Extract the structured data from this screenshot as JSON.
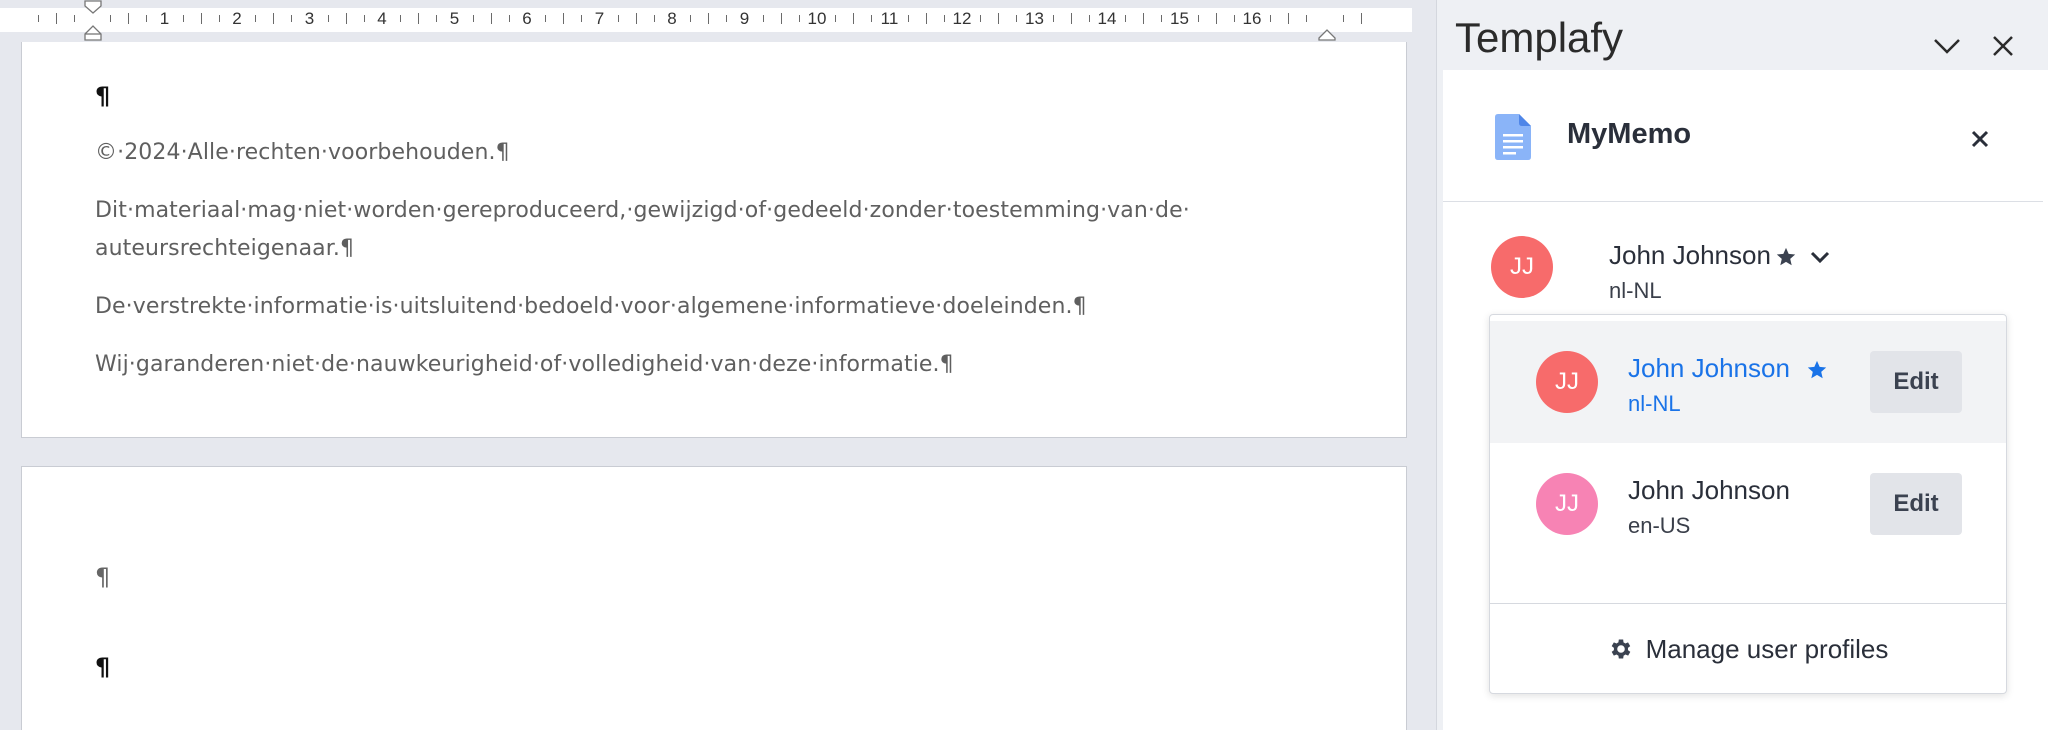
{
  "ruler": {
    "numbers": [
      "1",
      "2",
      "3",
      "4",
      "5",
      "6",
      "7",
      "8",
      "9",
      "10",
      "11",
      "12",
      "13",
      "14",
      "15",
      "16"
    ]
  },
  "document": {
    "page1": {
      "lines": [
        "©·2024·Alle·rechten·voorbehouden.¶",
        "Dit·materiaal·mag·niet·worden·gereproduceerd,·gewijzigd·of·gedeeld·zonder·toestemming·van·de·",
        "auteursrechteigenaar.¶",
        "De·verstrekte·informatie·is·uitsluitend·bedoeld·voor·algemene·informatieve·doeleinden.¶",
        "Wij·garanderen·niet·de·nauwkeurigheid·of·volledigheid·van·deze·informatie.¶"
      ],
      "top_mark": "¶"
    },
    "page2": {
      "marks": [
        "¶",
        "¶"
      ]
    }
  },
  "pane": {
    "title": "Templafy",
    "template": {
      "name": "MyMemo",
      "icon": "document-icon"
    },
    "current_profile": {
      "initials": "JJ",
      "name": "John Johnson",
      "locale": "nl-NL",
      "favorite": true
    },
    "profiles": [
      {
        "initials": "JJ",
        "name": "John Johnson",
        "locale": "nl-NL",
        "favorite": true,
        "edit_label": "Edit",
        "selected": true
      },
      {
        "initials": "JJ",
        "name": "John Johnson",
        "locale": "en-US",
        "favorite": false,
        "edit_label": "Edit",
        "selected": false
      }
    ],
    "manage_label": "Manage user profiles"
  },
  "colors": {
    "avatar_red": "#f76b6b",
    "avatar_pink": "#f783b4",
    "link_blue": "#1a73e8",
    "star_dark": "#3b4250"
  }
}
